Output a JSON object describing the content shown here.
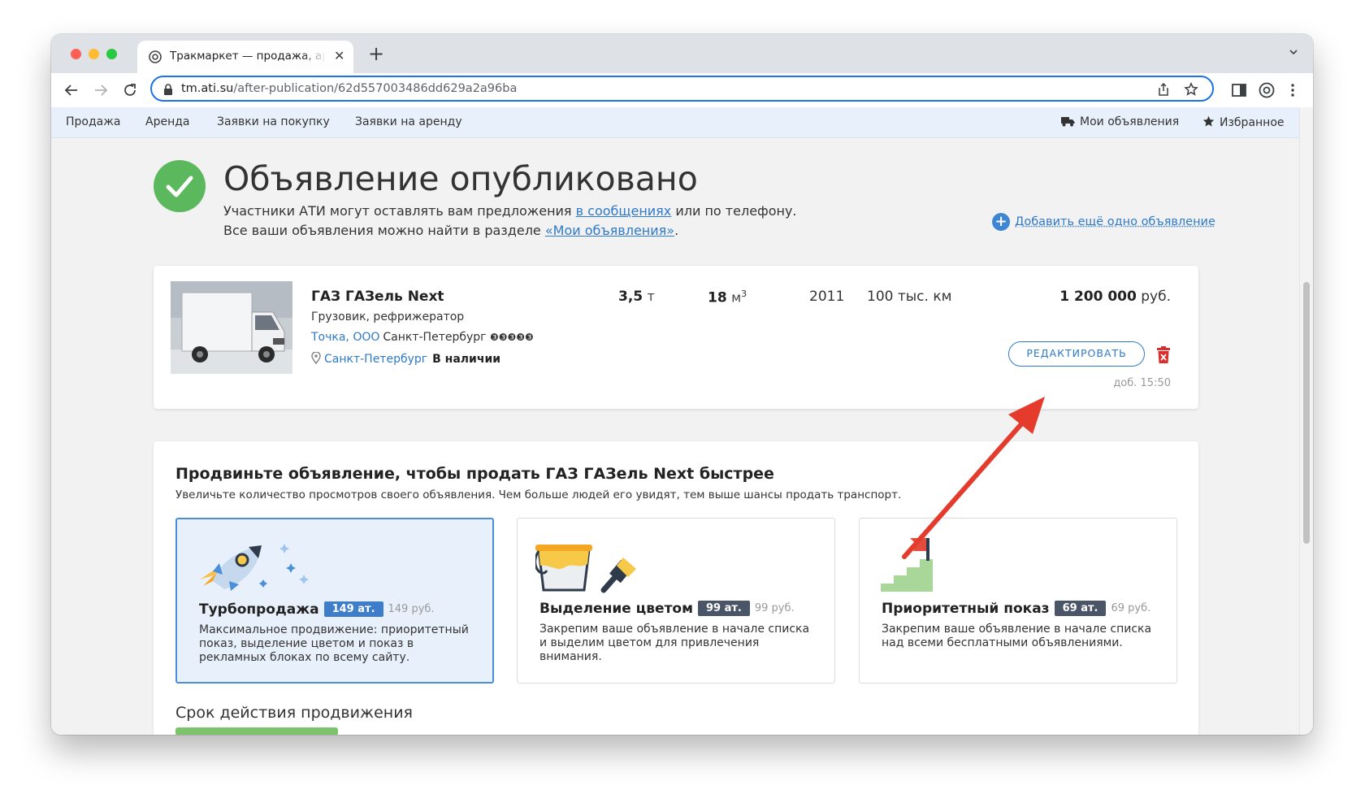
{
  "browser": {
    "tab_title": "Тракмаркет — продажа, аренда",
    "tab_close": "✕",
    "new_tab": "+",
    "url_host": "tm.ati.su",
    "url_path": "/after-publication/62d557003486dd629a2a96ba"
  },
  "nav": {
    "left": [
      "Продажа",
      "Аренда",
      "Заявки на покупку",
      "Заявки на аренду"
    ],
    "my_ads": "Мои объявления",
    "favorites": "Избранное"
  },
  "header": {
    "title": "Объявление опубликовано",
    "line1_before": "Участники АТИ могут оставлять вам предложения ",
    "line1_link": "в сообщениях",
    "line1_after": " или по телефону.",
    "line2_before": "Все ваши объявления можно найти в разделе ",
    "line2_link": "«Мои объявления»",
    "line2_after": ".",
    "add_more": "Добавить ещё одно объявление"
  },
  "listing": {
    "title": "ГАЗ ГАЗель Next",
    "type": "Грузовик, рефрижератор",
    "company": "Точка, ООО",
    "company_city": "Санкт-Петербург",
    "rating_marks": "❸❸❸❸❸",
    "location": "Санкт-Петербург",
    "availability": "В наличии",
    "capacity_value": "3,5",
    "capacity_unit": "т",
    "volume_value": "18",
    "volume_unit": "м",
    "volume_sup": "3",
    "year": "2011",
    "mileage": "100 тыс. км",
    "price_value": "1 200 000",
    "price_unit": "руб.",
    "edit_label": "РЕДАКТИРОВАТЬ",
    "added": "доб. 15:50"
  },
  "promo": {
    "title": "Продвиньте объявление, чтобы продать ГАЗ ГАЗель Next быстрее",
    "subtitle": "Увеличьте количество просмотров своего объявления. Чем больше людей его увидят, тем выше шансы продать транспорт.",
    "options": [
      {
        "name": "Турбопродажа",
        "badge": "149 ат.",
        "old_price": "149 руб.",
        "desc": "Максимальное продвижение: приоритетный показ, выделение цветом и показ в рекламных блоках по всему сайту.",
        "selected": true
      },
      {
        "name": "Выделение цветом",
        "badge": "99 ат.",
        "old_price": "99 руб.",
        "desc": "Закрепим ваше объявление в начале списка и выделим цветом для привлечения внимания.",
        "selected": false
      },
      {
        "name": "Приоритетный показ",
        "badge": "69 ат.",
        "old_price": "69 руб.",
        "desc": "Закрепим ваше объявление в начале списка над всеми бесплатными объявлениями.",
        "selected": false
      }
    ],
    "term_title": "Срок действия продвижения"
  },
  "colors": {
    "accent": "#2e79c8",
    "success": "#5cb85c",
    "annotation_arrow": "#e53b2c",
    "delete": "#d9302e"
  }
}
